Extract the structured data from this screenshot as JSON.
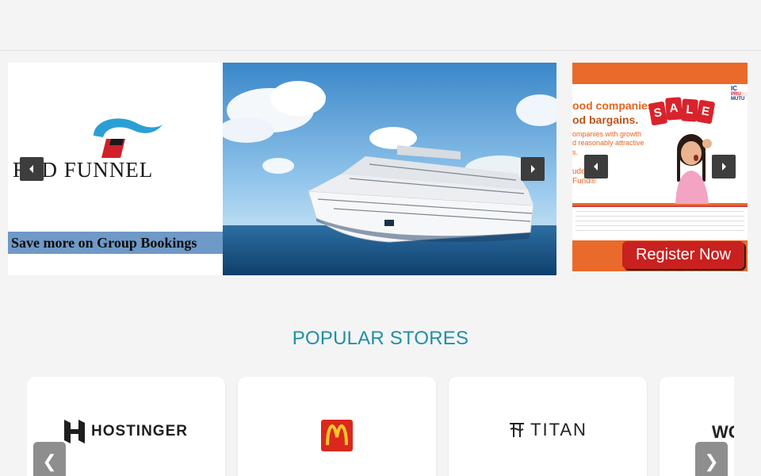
{
  "banner1": {
    "brand_name": "RED FUNNEL",
    "tagline": "Save more on Group Bookings",
    "prev_icon": "triangle-left-icon",
    "next_icon": "triangle-right-icon"
  },
  "banner2": {
    "headline_1": "ood companies",
    "headline_2": "od bargains.",
    "sub_1": "ompanies with growth",
    "sub_2": "d reasonably attractive",
    "sub_3": "s.",
    "fund_1": "uden",
    "fund_2": "Fund®",
    "sale_letters": [
      "S",
      "A",
      "L",
      "E"
    ],
    "logo_text_1": "IC",
    "logo_text_2": "PRU",
    "logo_text_3": "MUTU",
    "register_label": "Register Now"
  },
  "section": {
    "title": "POPULAR STORES"
  },
  "stores": [
    {
      "name": "HOSTINGER",
      "icon": "hostinger-logo-icon"
    },
    {
      "name": "McDonald's",
      "icon": "mcdonalds-logo-icon"
    },
    {
      "name": "TITAN",
      "icon": "titan-logo-icon"
    },
    {
      "name": "WC",
      "icon": "wc-logo-icon"
    }
  ],
  "store_nav": {
    "prev": "❮",
    "next": "❯"
  },
  "colors": {
    "accent": "#1f8fa5",
    "tagline_bg": "#6f99c6",
    "ad_orange": "#ea6a2b",
    "register_red": "#c9211f",
    "mcd_red": "#da291c",
    "mcd_yellow": "#ffc72c"
  }
}
